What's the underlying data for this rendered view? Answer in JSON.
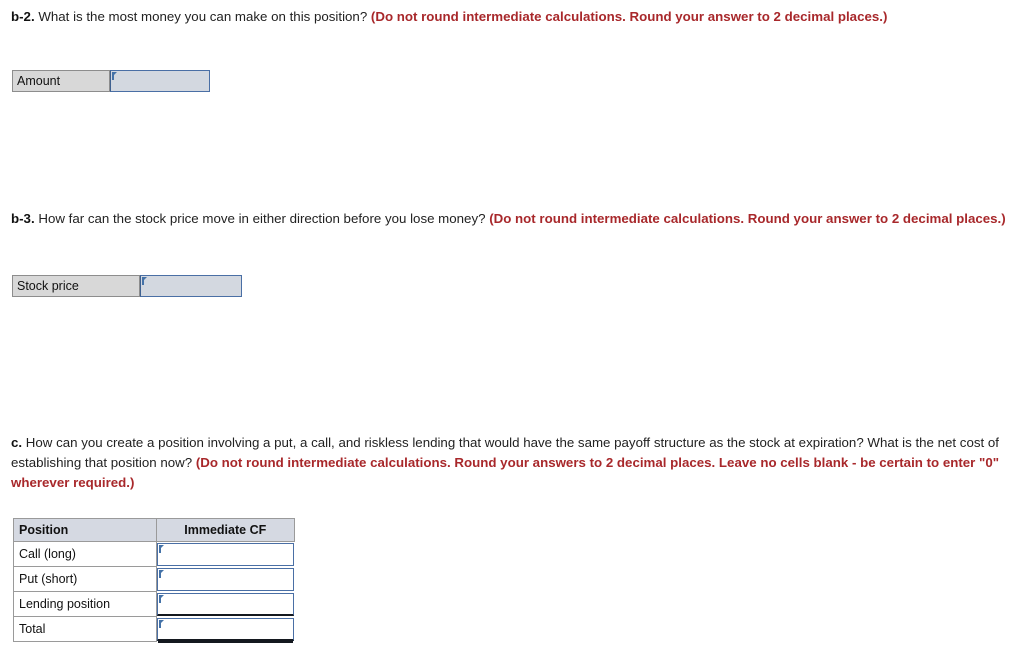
{
  "questions": {
    "b2": {
      "label": "b-2.",
      "text": " What is the most money you can make on this position? ",
      "note": "(Do not round intermediate calculations. Round your answer to 2 decimal places.)"
    },
    "b3": {
      "label": "b-3.",
      "text": " How far can the stock price move in either direction before you lose money? ",
      "note": "(Do not round intermediate calculations. Round your answer to 2 decimal places.)"
    },
    "c": {
      "label": "c.",
      "text": " How can you create a position involving a put, a call, and riskless lending that would have the same payoff structure as the stock at expiration? What is the net cost of establishing that position now? ",
      "note": "(Do not round intermediate calculations. Round your answers to 2 decimal places. Leave no cells blank - be certain to enter \"0\" wherever required.)"
    }
  },
  "answer_fields": {
    "amount": {
      "label": "Amount",
      "value": "",
      "placeholder": "",
      "marker_icon": "blue-corner-flag-icon"
    },
    "stock_price": {
      "label": "Stock price",
      "value": "",
      "placeholder": "",
      "marker_icon": "blue-corner-flag-icon"
    }
  },
  "position_table": {
    "headers": [
      "Position",
      "Immediate CF"
    ],
    "rows": [
      {
        "position": "Call (long)",
        "immediate_cf": "",
        "placeholder": ""
      },
      {
        "position": "Put (short)",
        "immediate_cf": "",
        "placeholder": ""
      },
      {
        "position": "Lending position",
        "immediate_cf": "",
        "placeholder": ""
      },
      {
        "position": "Total",
        "immediate_cf": "",
        "placeholder": ""
      }
    ]
  },
  "colors": {
    "note_red": "#a8282b",
    "input_border_blue": "#4a6fa5",
    "input_fill": "#d3d8e0",
    "label_fill": "#d8d8d8",
    "header_fill": "#d5d9e2",
    "total_rule": "#14181f"
  }
}
